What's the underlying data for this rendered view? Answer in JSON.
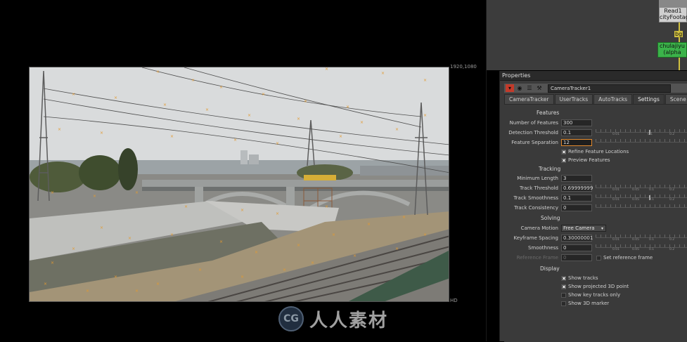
{
  "viewer": {
    "resolution_label": "1920,1080",
    "format_label": "HD"
  },
  "watermark": {
    "logo_text": "CG",
    "text": "人人素材"
  },
  "node_graph": {
    "read_node_label": "Read1",
    "read_node_file": "cityFootage_",
    "bg_label": "bg",
    "grade_node_label": "chulajiyu",
    "grade_node_sub": "(alpha"
  },
  "properties": {
    "title": "Properties",
    "node_name": "CameraTracker1",
    "tabs": [
      {
        "label": "CameraTracker"
      },
      {
        "label": "UserTracks"
      },
      {
        "label": "AutoTracks"
      },
      {
        "label": "Settings"
      },
      {
        "label": "Scene"
      }
    ],
    "active_tab": "Settings",
    "features": {
      "section": "Features",
      "number_label": "Number of Features",
      "number_value": "300",
      "detection_label": "Detection Threshold",
      "detection_value": "0.1",
      "separation_label": "Feature Separation",
      "separation_value": "12",
      "refine_label": "Refine Feature Locations",
      "refine_checked": true,
      "preview_label": "Preview Features",
      "preview_checked": true
    },
    "tracking": {
      "section": "Tracking",
      "min_length_label": "Minimum Length",
      "min_length_value": "3",
      "threshold_label": "Track Threshold",
      "threshold_value": "0.69999999",
      "smoothness_label": "Track Smoothness",
      "smoothness_value": "0.1",
      "consistency_label": "Track Consistency",
      "consistency_value": "0"
    },
    "solving": {
      "section": "Solving",
      "motion_label": "Camera Motion",
      "motion_value": "Free Camera",
      "keyframe_label": "Keyframe Spacing",
      "keyframe_value": "0.30000001",
      "smoothness_label": "Smoothness",
      "smoothness_value": "0",
      "reference_label": "Reference Frame",
      "reference_value": "0",
      "set_reference_label": "Set reference frame",
      "set_reference_checked": false
    },
    "display": {
      "section": "Display",
      "show_tracks_label": "Show tracks",
      "show_tracks_checked": true,
      "show_3d_point_label": "Show projected 3D point",
      "show_3d_point_checked": true,
      "show_key_tracks_label": "Show key tracks only",
      "show_key_tracks_checked": false,
      "show_3d_marker_label": "Show 3D marker",
      "show_3d_marker_checked": false
    },
    "slider_marks": {
      "a": [
        "0.01",
        "0.1",
        "0.2"
      ],
      "b": [
        "0.01",
        "0.05",
        "0.1",
        "0.2"
      ]
    },
    "check_mark": "✖"
  }
}
